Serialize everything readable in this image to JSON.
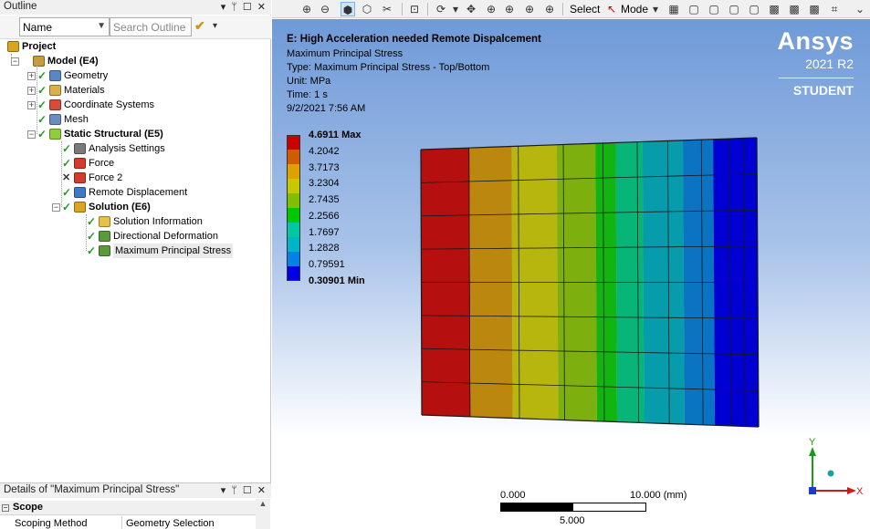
{
  "outline": {
    "title": "Outline",
    "pane_buttons": [
      "▾",
      "ᛘ",
      "☐",
      "✕"
    ],
    "filter_select_value": "Name",
    "search_placeholder": "Search Outline",
    "tree": [
      {
        "label": "Project",
        "bold": true,
        "level": 0,
        "expander": "",
        "check": "",
        "icon": "project-icon",
        "color": "#d9a520"
      },
      {
        "label": "Model (E4)",
        "bold": true,
        "level": 1,
        "expander": "−",
        "check": "",
        "icon": "model-icon",
        "color": "#c89a3c"
      },
      {
        "label": "Geometry",
        "bold": false,
        "level": 2,
        "expander": "+",
        "check": "✓",
        "icon": "geometry-icon",
        "color": "#5a86c5"
      },
      {
        "label": "Materials",
        "bold": false,
        "level": 2,
        "expander": "+",
        "check": "✓",
        "icon": "materials-icon",
        "color": "#d9b04a"
      },
      {
        "label": "Coordinate Systems",
        "bold": false,
        "level": 2,
        "expander": "+",
        "check": "✓",
        "icon": "coordinate-systems-icon",
        "color": "#d84a3a"
      },
      {
        "label": "Mesh",
        "bold": false,
        "level": 2,
        "expander": "",
        "check": "✓",
        "icon": "mesh-icon",
        "color": "#6a8cc0"
      },
      {
        "label": "Static Structural (E5)",
        "bold": true,
        "level": 2,
        "expander": "−",
        "check": "✓",
        "icon": "static-structural-icon",
        "color": "#8ccf3b"
      },
      {
        "label": "Analysis Settings",
        "bold": false,
        "level": 3,
        "expander": "",
        "check": "✓",
        "icon": "analysis-settings-icon",
        "color": "#7a7a7a"
      },
      {
        "label": "Force",
        "bold": false,
        "level": 3,
        "expander": "",
        "check": "✓",
        "icon": "force-icon",
        "color": "#d33b2c"
      },
      {
        "label": "Force 2",
        "bold": false,
        "level": 3,
        "expander": "",
        "check": "✕",
        "icon": "force-icon",
        "color": "#d33b2c"
      },
      {
        "label": "Remote Displacement",
        "bold": false,
        "level": 3,
        "expander": "",
        "check": "✓",
        "icon": "remote-displacement-icon",
        "color": "#3e78c9"
      },
      {
        "label": "Solution (E6)",
        "bold": true,
        "level": 3,
        "expander": "−",
        "check": "✓",
        "icon": "solution-icon",
        "color": "#d9a520"
      },
      {
        "label": "Solution Information",
        "bold": false,
        "level": 4,
        "expander": "",
        "check": "✓",
        "icon": "solution-information-icon",
        "color": "#e7c04a"
      },
      {
        "label": "Directional Deformation",
        "bold": false,
        "level": 4,
        "expander": "",
        "check": "✓",
        "icon": "result-icon",
        "color": "#5a9a3c"
      },
      {
        "label": "Maximum Principal Stress",
        "bold": false,
        "level": 4,
        "expander": "",
        "check": "✓",
        "icon": "result-icon",
        "color": "#5a9a3c",
        "selected": true
      }
    ]
  },
  "details": {
    "title": "Details of \"Maximum Principal Stress\"",
    "pane_buttons": [
      "▾",
      "ᛘ",
      "☐",
      "✕"
    ],
    "section": "Scope",
    "section_toggle": "−",
    "rows": [
      {
        "name": "Scoping Method",
        "value": "Geometry Selection"
      }
    ]
  },
  "toolbar": {
    "select_label": "Select",
    "mode_label": "Mode",
    "icons": [
      "zoom-to-fit-icon",
      "zoom-icon",
      "solid-view-icon",
      "wireframe-icon",
      "section-icon",
      "box-zoom-icon",
      "rotate-icon",
      "pan-icon",
      "zoom-in-icon",
      "zoom-out-icon",
      "magnify-icon",
      "look-at-icon"
    ]
  },
  "viewport": {
    "title": "E: High Acceleration needed Remote Dispalcement",
    "info_lines": [
      "Maximum Principal Stress",
      "Type: Maximum Principal Stress - Top/Bottom",
      "Unit: MPa",
      "Time: 1 s",
      "9/2/2021 7:56 AM"
    ],
    "brand": {
      "name": "Ansys",
      "version": "2021 R2",
      "edition": "STUDENT"
    },
    "legend": {
      "labels": [
        "4.6911 Max",
        "4.2042",
        "3.7173",
        "3.2304",
        "2.7435",
        "2.2566",
        "1.7697",
        "1.2828",
        "0.79591",
        "0.30901 Min"
      ],
      "colors": [
        "#c80000",
        "#d25a00",
        "#e0a000",
        "#c8c800",
        "#82be00",
        "#00c800",
        "#00c8a0",
        "#00b4c8",
        "#0082e6",
        "#0000e6"
      ]
    },
    "contour_colors": [
      "#b50f0f",
      "#bb870f",
      "#b6b60f",
      "#7db00f",
      "#12b412",
      "#07b578",
      "#069cab",
      "#0a74c2",
      "#0000d2"
    ],
    "scale": {
      "left": "0.000",
      "right": "10.000 (mm)",
      "mid": "5.000"
    },
    "triad": {
      "y": "Y",
      "x": "X"
    }
  }
}
